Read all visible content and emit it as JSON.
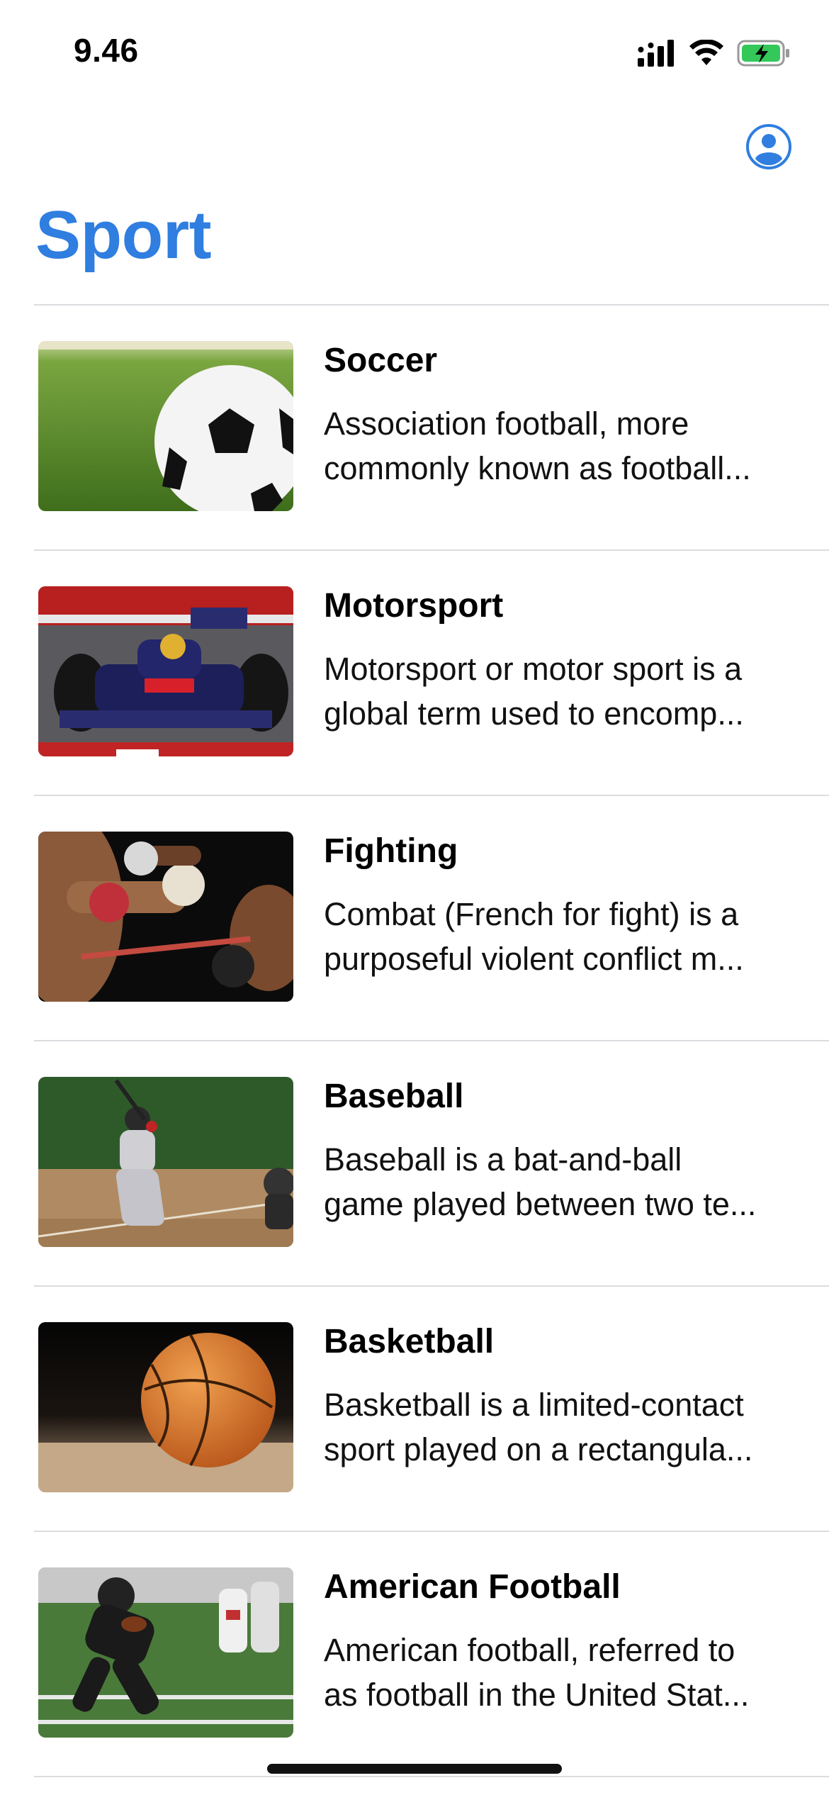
{
  "status_bar": {
    "time": "9.46",
    "icons": [
      "cellular-signal-icon",
      "wifi-icon",
      "battery-charging-icon"
    ],
    "battery_color": "#34c759"
  },
  "nav": {
    "title": "Sport",
    "title_color": "#2f7ee0",
    "profile_icon": "person-circle-icon"
  },
  "sports": [
    {
      "title": "Soccer",
      "desc_line1": "Association football, more",
      "desc_line2": "commonly known as football..."
    },
    {
      "title": "Motorsport",
      "desc_line1": "Motorsport or motor sport is a",
      "desc_line2": "global term used to encomp..."
    },
    {
      "title": "Fighting",
      "desc_line1": "Combat (French for fight) is a",
      "desc_line2": "purposeful violent conflict m..."
    },
    {
      "title": "Baseball",
      "desc_line1": "Baseball is a bat-and-ball",
      "desc_line2": "game played between two te..."
    },
    {
      "title": "Basketball",
      "desc_line1": "Basketball is a limited-contact",
      "desc_line2": "sport played on a rectangula..."
    },
    {
      "title": "American Football",
      "desc_line1": "American football, referred to",
      "desc_line2": "as football in the United Stat..."
    }
  ]
}
